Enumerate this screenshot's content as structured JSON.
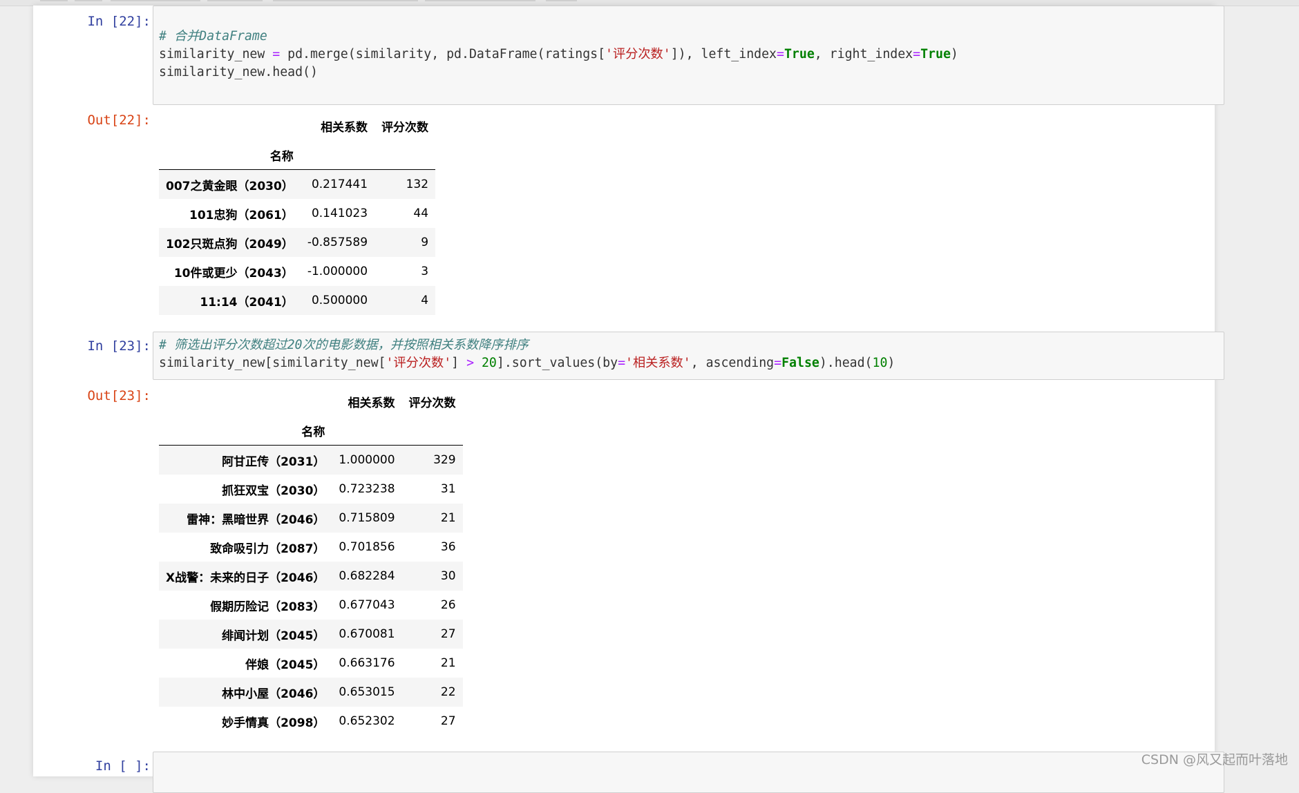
{
  "cells": [
    {
      "in_prompt": "In  [22]:",
      "code_lines": [
        [
          {
            "t": "# 合并DataFrame",
            "c": "comment"
          }
        ],
        [
          {
            "t": "similarity_new ",
            "c": "plain"
          },
          {
            "t": "=",
            "c": "op"
          },
          {
            "t": " pd.merge(similarity, pd.DataFrame(ratings[",
            "c": "plain"
          },
          {
            "t": "'评分次数'",
            "c": "str"
          },
          {
            "t": "]), left_index",
            "c": "plain"
          },
          {
            "t": "=",
            "c": "op"
          },
          {
            "t": "True",
            "c": "kw"
          },
          {
            "t": ", right_index",
            "c": "plain"
          },
          {
            "t": "=",
            "c": "op"
          },
          {
            "t": "True",
            "c": "kw"
          },
          {
            "t": ")",
            "c": "plain"
          }
        ],
        [
          {
            "t": "similarity_new.head()",
            "c": "plain"
          }
        ]
      ],
      "out_prompt": "Out[22]:",
      "table": {
        "columns": [
          "相关系数",
          "评分次数"
        ],
        "index_name": "名称",
        "rows": [
          {
            "index": "007之黄金眼（2030）",
            "values": [
              "0.217441",
              "132"
            ]
          },
          {
            "index": "101忠狗（2061）",
            "values": [
              "0.141023",
              "44"
            ]
          },
          {
            "index": "102只斑点狗（2049）",
            "values": [
              "-0.857589",
              "9"
            ]
          },
          {
            "index": "10件或更少（2043）",
            "values": [
              "-1.000000",
              "3"
            ]
          },
          {
            "index": "11:14（2041）",
            "values": [
              "0.500000",
              "4"
            ]
          }
        ]
      }
    },
    {
      "in_prompt": "In  [23]:",
      "code_lines": [
        [
          {
            "t": "# 筛选出评分次数超过20次的电影数据，并按照相关系数降序排序",
            "c": "comment"
          }
        ],
        [
          {
            "t": "similarity_new[similarity_new[",
            "c": "plain"
          },
          {
            "t": "'评分次数'",
            "c": "str"
          },
          {
            "t": "] ",
            "c": "plain"
          },
          {
            "t": ">",
            "c": "op"
          },
          {
            "t": " ",
            "c": "plain"
          },
          {
            "t": "20",
            "c": "num"
          },
          {
            "t": "].sort_values(by",
            "c": "plain"
          },
          {
            "t": "=",
            "c": "op"
          },
          {
            "t": "'相关系数'",
            "c": "str"
          },
          {
            "t": ", ascending",
            "c": "plain"
          },
          {
            "t": "=",
            "c": "op"
          },
          {
            "t": "False",
            "c": "kw"
          },
          {
            "t": ").head(",
            "c": "plain"
          },
          {
            "t": "10",
            "c": "num"
          },
          {
            "t": ")",
            "c": "plain"
          }
        ]
      ],
      "out_prompt": "Out[23]:",
      "table": {
        "columns": [
          "相关系数",
          "评分次数"
        ],
        "index_name": "名称",
        "rows": [
          {
            "index": "阿甘正传（2031）",
            "values": [
              "1.000000",
              "329"
            ]
          },
          {
            "index": "抓狂双宝（2030）",
            "values": [
              "0.723238",
              "31"
            ]
          },
          {
            "index": "雷神：黑暗世界（2046）",
            "values": [
              "0.715809",
              "21"
            ]
          },
          {
            "index": "致命吸引力（2087）",
            "values": [
              "0.701856",
              "36"
            ]
          },
          {
            "index": "X战警：未来的日子（2046）",
            "values": [
              "0.682284",
              "30"
            ]
          },
          {
            "index": "假期历险记（2083）",
            "values": [
              "0.677043",
              "26"
            ]
          },
          {
            "index": "绯闻计划（2045）",
            "values": [
              "0.670081",
              "27"
            ]
          },
          {
            "index": "伴娘（2045）",
            "values": [
              "0.663176",
              "21"
            ]
          },
          {
            "index": "林中小屋（2046）",
            "values": [
              "0.653015",
              "22"
            ]
          },
          {
            "index": "妙手情真（2098）",
            "values": [
              "0.652302",
              "27"
            ]
          }
        ]
      }
    },
    {
      "in_prompt": "In  [  ]:"
    }
  ],
  "watermark": "CSDN @风又起而叶落地",
  "colors": {
    "in_prompt": "#303f9f",
    "out_prompt": "#d84315",
    "comment": "#408080",
    "operator": "#aa22ff",
    "string": "#ba2121",
    "keyword": "#008000"
  }
}
